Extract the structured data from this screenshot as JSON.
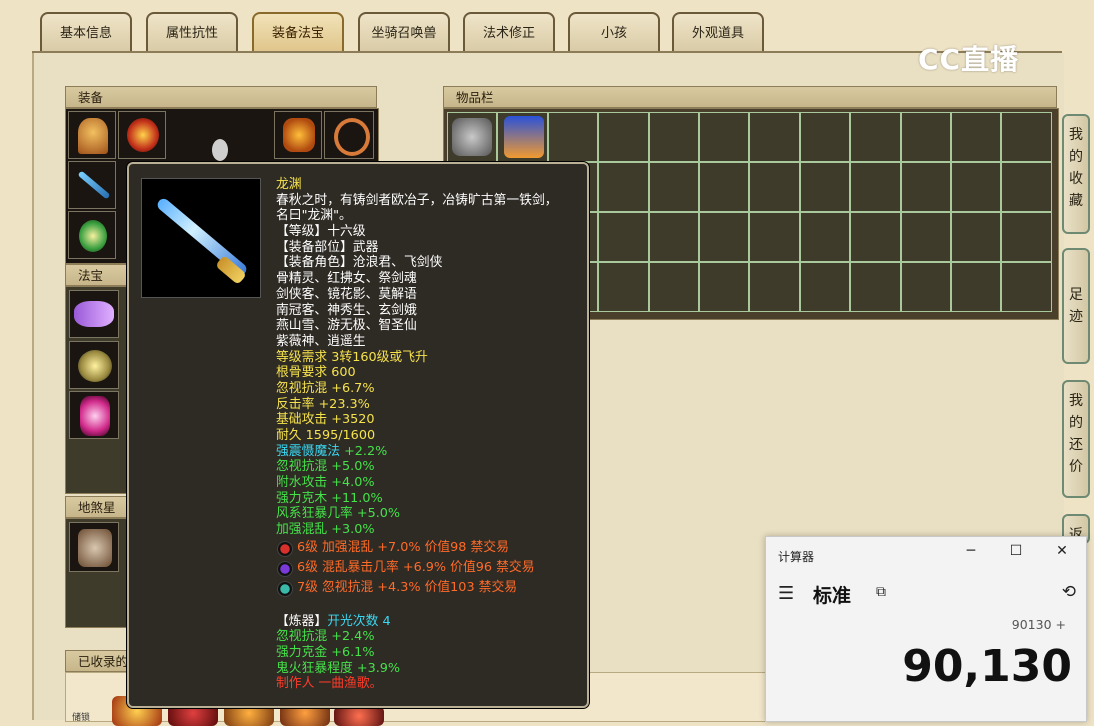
{
  "tabs": [
    "基本信息",
    "属性抗性",
    "装备法宝",
    "坐骑召唤兽",
    "法术修正",
    "小孩",
    "外观道具"
  ],
  "active_tab": "装备法宝",
  "sections": {
    "equipment": "装备",
    "inventory": "物品栏",
    "treasure": "法宝",
    "earth": "地煞星",
    "collected": "已收录的"
  },
  "side_tabs": [
    {
      "label": "我的收藏"
    },
    {
      "label": "足迹"
    },
    {
      "label": "我的还价"
    },
    {
      "label": "返"
    }
  ],
  "watermark": "CC直播",
  "tooltip": {
    "name": "龙渊",
    "desc": [
      "春秋之时，有铸剑者欧冶子，冶铸旷古第一铁剑，",
      "名曰\"龙渊\"。"
    ],
    "white_lines": [
      "【等级】十六级",
      "【装备部位】武器",
      "【装备角色】沧浪君、飞剑侠",
      "骨精灵、红拂女、祭剑魂",
      "剑侠客、镜花影、莫解语",
      "南冠客、神秀生、玄剑娥",
      "燕山雪、游无极、智圣仙",
      "紫薇神、逍遥生"
    ],
    "yellow_lines": [
      "等级需求 3转160级或飞升",
      "根骨要求 600",
      "忽视抗混 +6.7%",
      "反击率 +23.3%",
      "基础攻击 +3520",
      "耐久 1595/1600"
    ],
    "attr_lines": [
      {
        "name": "强震慑魔法",
        "value": "+2.2%",
        "color": "cyan"
      },
      {
        "name": "忽视抗混",
        "value": "+5.0%",
        "color": "green"
      },
      {
        "name": "附水攻击",
        "value": "+4.0%",
        "color": "green"
      },
      {
        "name": "强力克木",
        "value": "+11.0%",
        "color": "green"
      },
      {
        "name": "风系狂暴几率",
        "value": "+5.0%",
        "color": "green"
      },
      {
        "name": "加强混乱",
        "value": "+3.0%",
        "color": "green"
      }
    ],
    "gems": [
      {
        "text": "6级 加强混乱 +7.0% 价值98 禁交易",
        "color": "#d8302a"
      },
      {
        "text": "6级 混乱暴击几率 +6.9% 价值96 禁交易",
        "color": "#7a3ad8"
      },
      {
        "text": "7级 忽视抗混 +4.3% 价值103 禁交易",
        "color": "#3ab8a8"
      }
    ],
    "refine_label": "【炼器】",
    "refine_count": "开光次数 4",
    "refine_lines": [
      "忽视抗混 +2.4%",
      "强力克金 +6.1%",
      "鬼火狂暴程度 +3.9%"
    ],
    "maker": "制作人 一曲渔歌。"
  },
  "calculator": {
    "title": "计算器",
    "mode": "标准",
    "expression": "90130 +",
    "value": "90,130",
    "minimize": "─",
    "maximize": "☐",
    "close": "✕"
  },
  "collected_label_small": "储锁"
}
